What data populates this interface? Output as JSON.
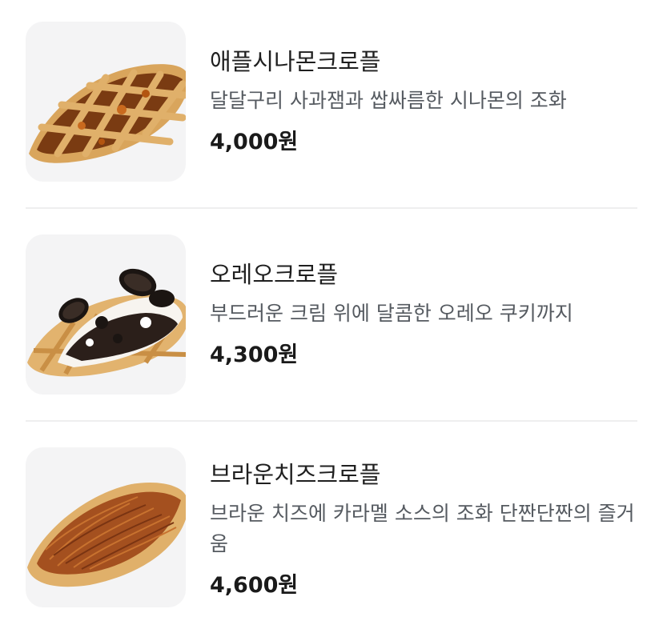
{
  "menu": {
    "items": [
      {
        "name": "애플시나몬크로플",
        "description": "달달구리 사과잼과 쌉싸름한 시나몬의 조화",
        "price": "4,000원",
        "image_icon": "apple-cinnamon-croffle-image"
      },
      {
        "name": "오레오크로플",
        "description": "부드러운 크림 위에 달콤한 오레오 쿠키까지",
        "price": "4,300원",
        "image_icon": "oreo-croffle-image"
      },
      {
        "name": "브라운치즈크로플",
        "description": "브라운 치즈에 카라멜 소스의 조화 단짠단짠의 즐거움",
        "price": "4,600원",
        "image_icon": "brown-cheese-croffle-image"
      }
    ]
  }
}
